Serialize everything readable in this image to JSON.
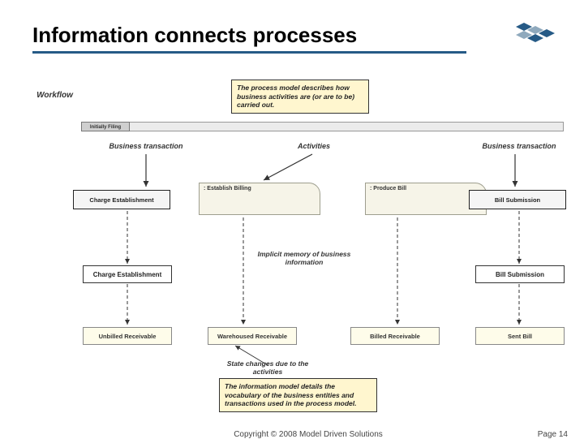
{
  "title": "Information connects processes",
  "labels": {
    "workflow": "Workflow",
    "business_transaction_left": "Business transaction",
    "activities": "Activities",
    "business_transaction_right": "Business transaction",
    "swim_tab": "Initially Filing"
  },
  "callouts": {
    "process_model": "The process model describes how business activities are (or are to be) carried out.",
    "info_model": "The information model details the vocabulary of the business entities and transactions used in the process model."
  },
  "notes": {
    "implicit": "Implicit memory of business information",
    "state_changes": "State changes due to the activities"
  },
  "activities": {
    "establish_billing": ": Establish Billing",
    "produce_bill": ": Produce Bill"
  },
  "bt_boxes": {
    "charge_establishment_arrow": "Charge Establishment",
    "bill_submission_arrow": "Bill Submission"
  },
  "plain_boxes": {
    "charge_establishment": "Charge Establishment",
    "bill_submission": "Bill Submission"
  },
  "state_boxes": {
    "unbilled_receivable": "Unbilled Receivable",
    "warehoused_receivable": "Warehoused Receivable",
    "billed_receivable": "Billed Receivable",
    "sent_bill": "Sent Bill"
  },
  "footer": {
    "copyright": "Copyright © 2008 Model Driven Solutions",
    "page": "Page 14"
  }
}
